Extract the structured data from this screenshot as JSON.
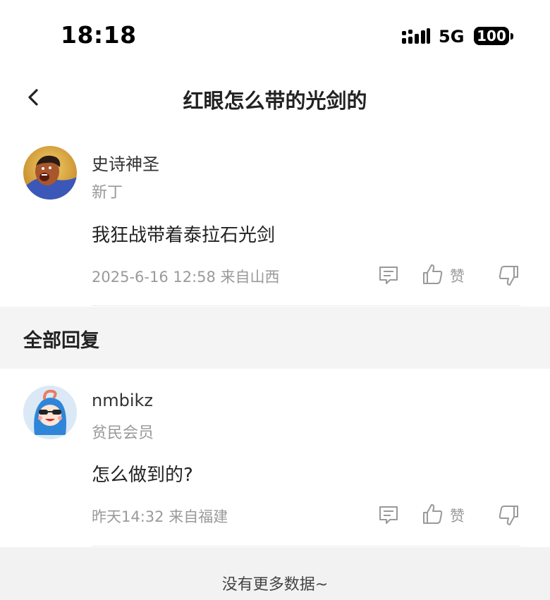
{
  "status_bar": {
    "time": "18:18",
    "network": "5G",
    "battery": "100"
  },
  "nav": {
    "title": "红眼怎么带的光剑的"
  },
  "main_post": {
    "username": "史诗神圣",
    "rank": "新丁",
    "content": "我狂战带着泰拉石光剑",
    "meta": "2025-6-16 12:58  来自山西",
    "like_label": "赞"
  },
  "replies_header": {
    "title": "全部回复"
  },
  "replies": [
    {
      "username": "nmbikz",
      "rank": "贫民会员",
      "content": "怎么做到的?",
      "meta": "昨天14:32  来自福建",
      "like_label": "赞"
    }
  ],
  "footer": {
    "text": "没有更多数据~"
  },
  "colors": {
    "secondary_text": "#9a9a9a",
    "section_bg": "#f4f4f4",
    "avatar_bg": "#dbe9f6"
  }
}
